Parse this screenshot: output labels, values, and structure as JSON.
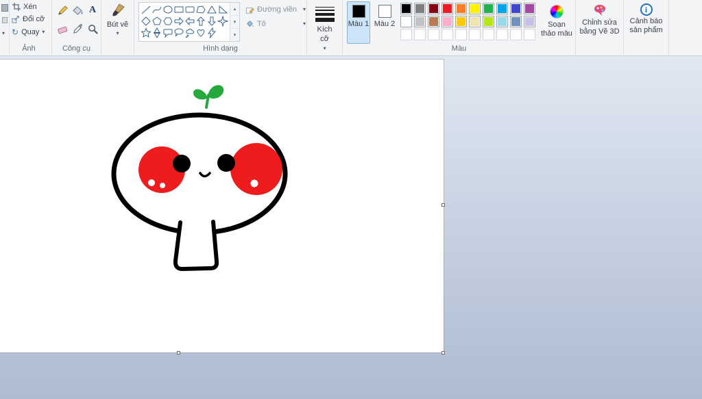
{
  "ribbon": {
    "image_section": {
      "label": "Ảnh",
      "crop": "Xén",
      "resize": "Đổi cỡ",
      "rotate": "Quay"
    },
    "tools_section": {
      "label": "Công cụ"
    },
    "brushes_button": {
      "label": "Bút vẽ"
    },
    "shapes_section": {
      "label": "Hình dạng",
      "outline_button": "Đường viền",
      "fill_button": "Tô",
      "shape_icons": [
        "line",
        "curve",
        "oval",
        "rectangle",
        "rounded-rectangle",
        "polygon",
        "triangle",
        "right-triangle",
        "diamond",
        "pentagon",
        "hexagon",
        "right-arrow",
        "left-arrow",
        "up-arrow",
        "down-arrow",
        "four-point-star",
        "five-point-star",
        "six-point-star",
        "rounded-callout",
        "oval-callout",
        "cloud-callout",
        "heart",
        "lightning"
      ]
    },
    "size_button": {
      "label": "Kích cỡ"
    },
    "colors_section": {
      "label": "Màu",
      "color1_label": "Màu 1",
      "color2_label": "Màu 2",
      "edit_colors_label": "Soạn thảo màu",
      "color1_value": "#000000",
      "color2_value": "#ffffff",
      "palette_row1": [
        "#000000",
        "#7f7f7f",
        "#880015",
        "#ed1c24",
        "#ff7f27",
        "#fff200",
        "#22b14c",
        "#00a2e8",
        "#3f48cc",
        "#a349a4"
      ],
      "palette_row2": [
        "#ffffff",
        "#c3c3c3",
        "#b97a57",
        "#ffaec9",
        "#ffc90e",
        "#efe4b0",
        "#b5e61d",
        "#99d9ea",
        "#7092be",
        "#c8bfe7"
      ],
      "palette_row3_empty": 10
    },
    "paint3d_button": {
      "label": "Chỉnh sửa bằng Vẽ 3D"
    },
    "alerts_button": {
      "label": "Cảnh báo sản phẩm"
    }
  },
  "canvas": {
    "drawing": {
      "outline_color": "#000000",
      "cheek_color": "#ee1c1c",
      "sprout_color": "#27a83c",
      "eye_color": "#000000"
    }
  }
}
